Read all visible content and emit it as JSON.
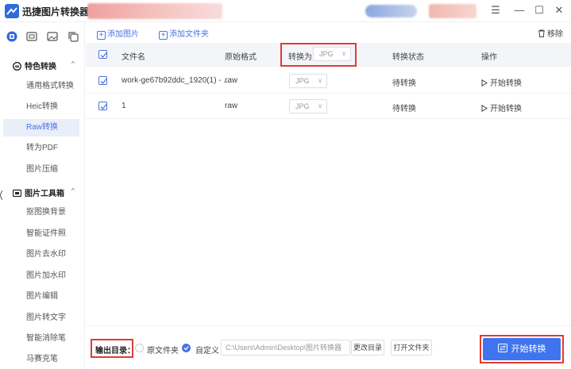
{
  "app": {
    "title": "迅捷图片转换器"
  },
  "window_controls": {
    "menu": "☰",
    "minimize": "—",
    "maximize": "☐",
    "close": "✕"
  },
  "sidebar": {
    "top_icons": [
      "home-icon",
      "image-icon",
      "picture-icon",
      "copy-icon"
    ],
    "groups": [
      {
        "label": "特色转换",
        "arrow": "^",
        "items": [
          "通用格式转换",
          "Heic转换",
          "Raw转换",
          "转为PDF",
          "图片压缩"
        ]
      },
      {
        "label": "图片工具箱",
        "arrow": "^",
        "items": [
          "抠图换背景",
          "智能证件照",
          "图片去水印",
          "图片加水印",
          "图片编辑",
          "图片转文字",
          "智能消除笔",
          "马赛克笔"
        ]
      }
    ],
    "active_item": "Raw转换"
  },
  "toolbar": {
    "add_image": "添加图片",
    "add_folder": "添加文件夹",
    "remove": "移除"
  },
  "table": {
    "headers": {
      "filename": "文件名",
      "format": "原始格式",
      "convert_to": "转换为",
      "status": "转换状态",
      "action": "操作"
    },
    "header_select": "JPG",
    "rows": [
      {
        "filename": "work-ge67b92ddc_1920(1) - ...",
        "format": "raw",
        "target": "JPG",
        "status": "待转换",
        "action": "开始转换",
        "checked": true
      },
      {
        "filename": "1",
        "format": "raw",
        "target": "JPG",
        "status": "待转换",
        "action": "开始转换",
        "checked": true
      }
    ]
  },
  "output": {
    "label": "输出目录：",
    "option_original": "原文件夹",
    "option_custom": "自定义",
    "path": "C:\\Users\\Admin\\Desktop\\图片转换器",
    "change_dir": "更改目录",
    "open_folder": "打开文件夹",
    "selected": "自定义"
  },
  "start_button": "开始转换",
  "colors": {
    "accent": "#3f74ee",
    "highlight_box": "#e23a35",
    "active_bg": "#e9eef9"
  }
}
